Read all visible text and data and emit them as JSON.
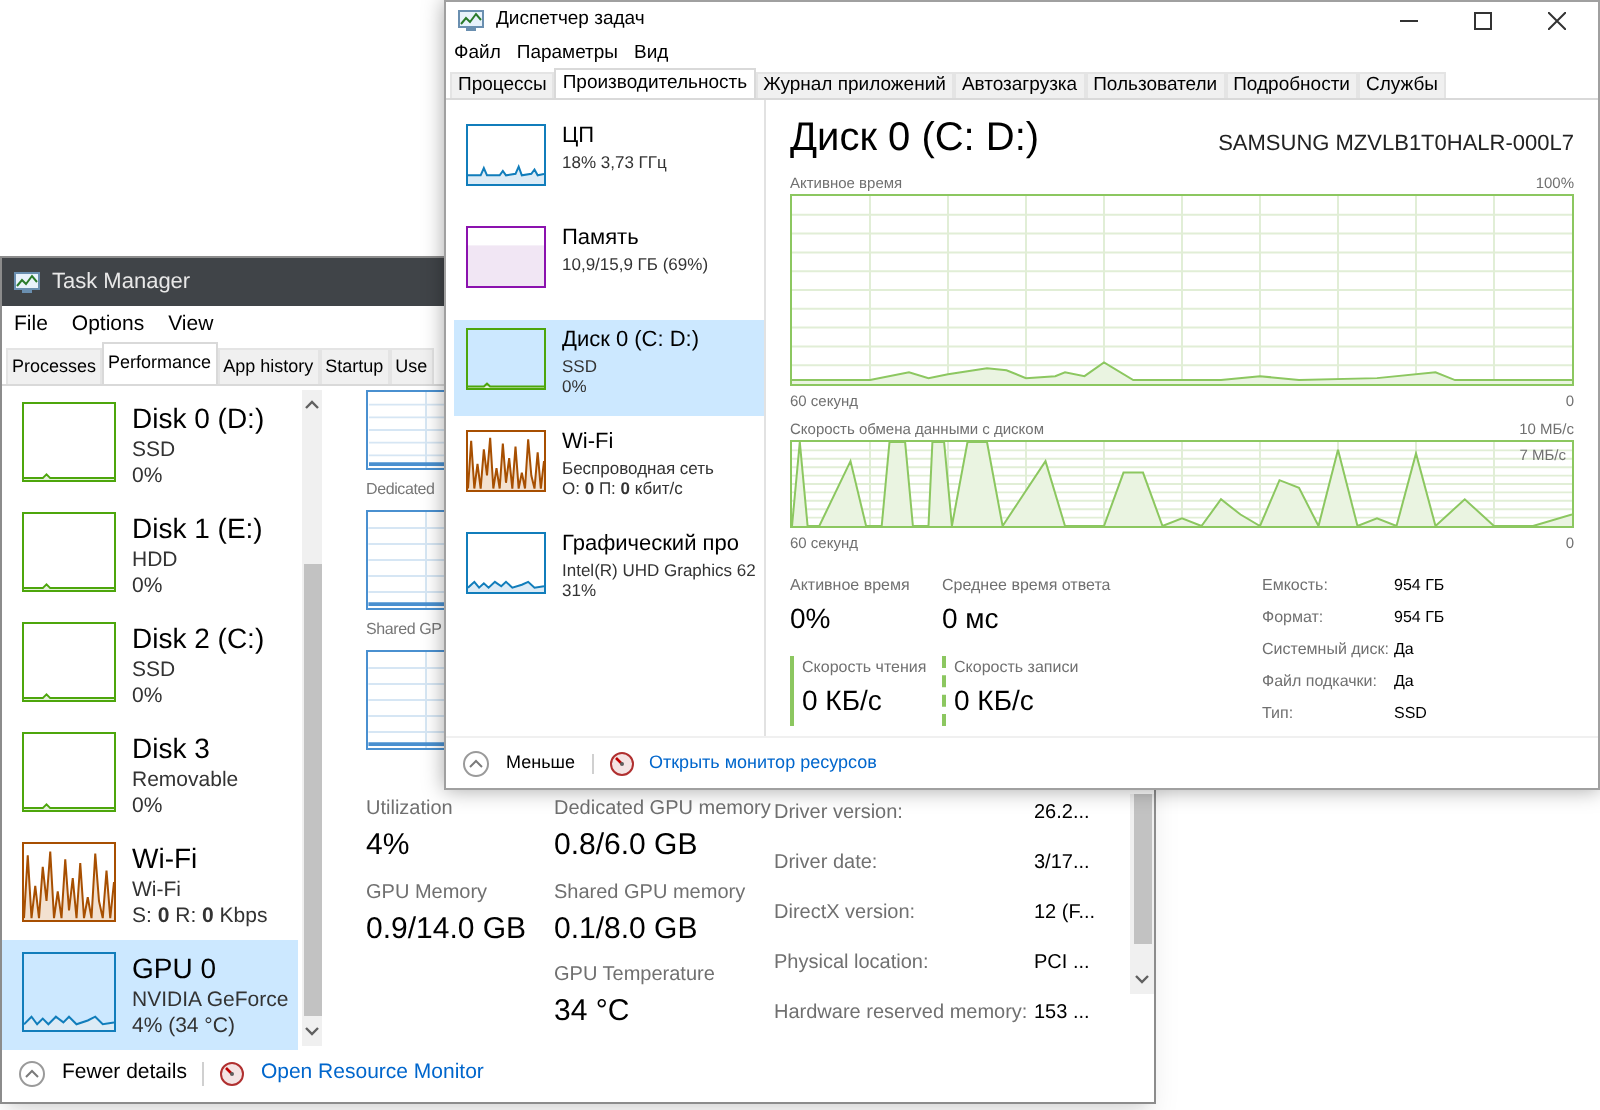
{
  "back_window": {
    "title": "Task Manager",
    "menu": [
      "File",
      "Options",
      "View"
    ],
    "tabs": [
      {
        "label": "Processes",
        "selected": false
      },
      {
        "label": "Performance",
        "selected": true
      },
      {
        "label": "App history",
        "selected": false
      },
      {
        "label": "Startup",
        "selected": false
      },
      {
        "label": "Use",
        "selected": false
      }
    ],
    "sidebar": [
      {
        "kind": "disk",
        "name": "Disk 0 (D:)",
        "lines": [
          "SSD",
          "0%"
        ],
        "selected": false
      },
      {
        "kind": "disk",
        "name": "Disk 1 (E:)",
        "lines": [
          "HDD",
          "0%"
        ],
        "selected": false
      },
      {
        "kind": "disk",
        "name": "Disk 2 (C:)",
        "lines": [
          "SSD",
          "0%"
        ],
        "selected": false
      },
      {
        "kind": "disk",
        "name": "Disk 3",
        "lines": [
          "Removable",
          "0%"
        ],
        "selected": false
      },
      {
        "kind": "wifi",
        "name": "Wi-Fi",
        "lines": [
          "Wi-Fi",
          "S: **0** R: **0** Kbps"
        ],
        "selected": false
      },
      {
        "kind": "gpu",
        "name": "GPU 0",
        "lines": [
          "NVIDIA GeForce",
          "4% (34 °C)"
        ],
        "selected": true
      }
    ],
    "graph_labels": [
      "Dedicated",
      "Shared GP"
    ],
    "stats": [
      [
        {
          "label": "Utilization",
          "value": "4%"
        },
        {
          "label": "GPU Memory",
          "value": "0.9/14.0 GB"
        }
      ],
      [
        {
          "label": "Dedicated GPU memory",
          "value": "0.8/6.0 GB"
        },
        {
          "label": "Shared GPU memory",
          "value": "0.1/8.0 GB"
        },
        {
          "label": "GPU Temperature",
          "value": "34 °C"
        }
      ]
    ],
    "details": [
      {
        "label": "Driver version:",
        "value": "26.2..."
      },
      {
        "label": "Driver date:",
        "value": "3/17..."
      },
      {
        "label": "DirectX version:",
        "value": "12 (F..."
      },
      {
        "label": "Physical location:",
        "value": "PCI ..."
      },
      {
        "label": "Hardware reserved memory:",
        "value": "153 ..."
      }
    ],
    "footer": {
      "fewer": "Fewer details",
      "monitor": "Open Resource Monitor"
    }
  },
  "front_window": {
    "title": "Диспетчер задач",
    "menu": [
      "Файл",
      "Параметры",
      "Вид"
    ],
    "tabs": [
      {
        "label": "Процессы",
        "selected": false
      },
      {
        "label": "Производительность",
        "selected": true
      },
      {
        "label": "Журнал приложений",
        "selected": false
      },
      {
        "label": "Автозагрузка",
        "selected": false
      },
      {
        "label": "Пользователи",
        "selected": false
      },
      {
        "label": "Подробности",
        "selected": false
      },
      {
        "label": "Службы",
        "selected": false
      }
    ],
    "sidebar": [
      {
        "kind": "cpu",
        "name": "ЦП",
        "lines": [
          "18% 3,73 ГГц"
        ],
        "selected": false
      },
      {
        "kind": "memory",
        "name": "Память",
        "lines": [
          "10,9/15,9 ГБ (69%)"
        ],
        "selected": false
      },
      {
        "kind": "disk",
        "name": "Диск 0 (C: D:)",
        "lines": [
          "SSD",
          "0%"
        ],
        "selected": true
      },
      {
        "kind": "wifi",
        "name": "Wi-Fi",
        "lines": [
          "Беспроводная сеть",
          "О: **0** П: **0** кбит/с"
        ],
        "selected": false
      },
      {
        "kind": "gpu",
        "name": "Графический про",
        "lines": [
          "Intel(R) UHD Graphics 62",
          "31%"
        ],
        "selected": false
      }
    ],
    "heading": "Диск 0 (C: D:)",
    "model": "SAMSUNG MZVLB1T0HALR-000L7",
    "graphs": [
      {
        "kind": "active",
        "title": "Активное время",
        "max": "100%",
        "time": "60 секунд",
        "min": "0"
      },
      {
        "kind": "transfer",
        "title": "Скорость обмена данными с диском",
        "max": "10 МБ/с",
        "inner": "7 МБ/с",
        "time": "60 секунд",
        "min": "0"
      }
    ],
    "stats": [
      {
        "kind": "plain",
        "label": "Активное время",
        "value": "0%"
      },
      {
        "kind": "plain",
        "label": "Среднее время ответа",
        "value": "0 мс"
      },
      {
        "kind": "read",
        "label": "Скорость чтения",
        "value": "0 КБ/с"
      },
      {
        "kind": "write",
        "label": "Скорость записи",
        "value": "0 КБ/с"
      }
    ],
    "details": [
      {
        "label": "Емкость:",
        "value": "954 ГБ"
      },
      {
        "label": "Формат:",
        "value": "954 ГБ"
      },
      {
        "label": "Системный диск:",
        "value": "Да"
      },
      {
        "label": "Файл подкачки:",
        "value": "Да"
      },
      {
        "label": "Тип:",
        "value": "SSD"
      }
    ],
    "footer": {
      "fewer": "Меньше",
      "monitor": "Открыть монитор ресурсов"
    }
  }
}
